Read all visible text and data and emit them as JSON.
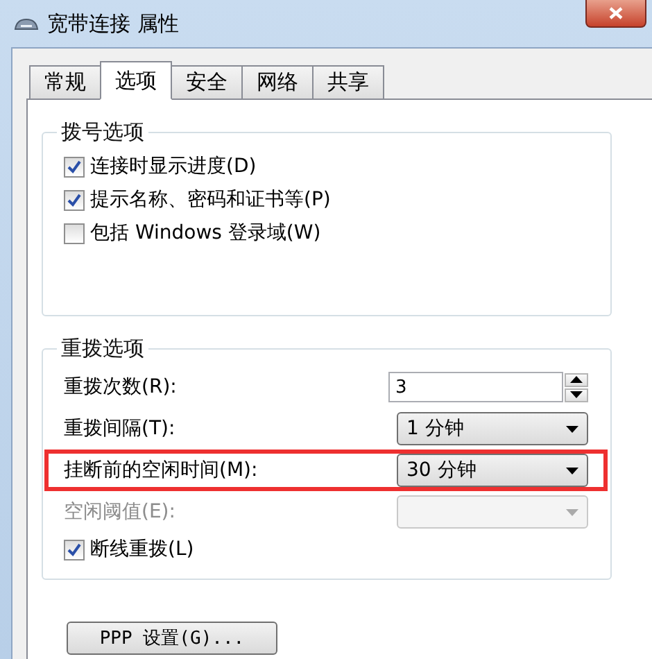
{
  "window": {
    "title": "宽带连接 属性"
  },
  "tabs": [
    {
      "label": "常规",
      "selected": false
    },
    {
      "label": "选项",
      "selected": true
    },
    {
      "label": "安全",
      "selected": false
    },
    {
      "label": "网络",
      "selected": false
    },
    {
      "label": "共享",
      "selected": false
    }
  ],
  "dialing": {
    "title": "拨号选项",
    "options": [
      {
        "label": "连接时显示进度(D)",
        "checked": true
      },
      {
        "label": "提示名称、密码和证书等(P)",
        "checked": true
      },
      {
        "label": "包括 Windows 登录域(W)",
        "checked": false
      }
    ]
  },
  "redial": {
    "title": "重拨选项",
    "fields": [
      {
        "kind": "spinner",
        "label": "重拨次数(R):",
        "value": "3",
        "disabled": false,
        "highlighted": false
      },
      {
        "kind": "combo",
        "label": "重拨间隔(T):",
        "value": "1 分钟",
        "disabled": false,
        "highlighted": false
      },
      {
        "kind": "combo",
        "label": "挂断前的空闲时间(M):",
        "value": "30 分钟",
        "disabled": false,
        "highlighted": true
      },
      {
        "kind": "combo",
        "label": "空闲阈值(E):",
        "disabled": true,
        "highlighted": false
      }
    ],
    "options": [
      {
        "label": "断线重拨(L)",
        "checked": true
      }
    ]
  },
  "buttons": [
    {
      "label": "PPP 设置(G)..."
    }
  ]
}
